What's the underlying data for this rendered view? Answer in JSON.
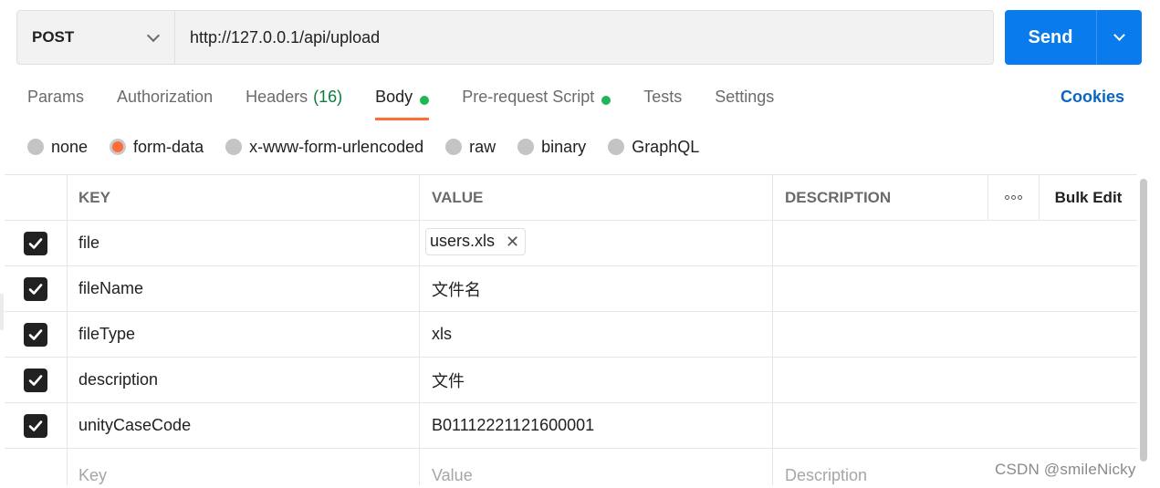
{
  "request": {
    "method": "POST",
    "url": "http://127.0.0.1/api/upload",
    "send_label": "Send"
  },
  "tabs": [
    {
      "label": "Params",
      "active": false
    },
    {
      "label": "Authorization",
      "active": false
    },
    {
      "label": "Headers",
      "count": "(16)",
      "active": false
    },
    {
      "label": "Body",
      "active": true,
      "dot": true
    },
    {
      "label": "Pre-request Script",
      "active": false,
      "dot": true
    },
    {
      "label": "Tests",
      "active": false
    },
    {
      "label": "Settings",
      "active": false
    }
  ],
  "cookies_label": "Cookies",
  "body_types": [
    {
      "label": "none",
      "selected": false
    },
    {
      "label": "form-data",
      "selected": true
    },
    {
      "label": "x-www-form-urlencoded",
      "selected": false
    },
    {
      "label": "raw",
      "selected": false
    },
    {
      "label": "binary",
      "selected": false
    },
    {
      "label": "GraphQL",
      "selected": false
    }
  ],
  "table": {
    "headers": {
      "key": "KEY",
      "value": "VALUE",
      "description": "DESCRIPTION",
      "bulk_edit": "Bulk Edit"
    },
    "rows": [
      {
        "key": "file",
        "value": "users.xls",
        "is_file": true,
        "description": "",
        "checked": true
      },
      {
        "key": "fileName",
        "value": "文件名",
        "description": "",
        "checked": true
      },
      {
        "key": "fileType",
        "value": "xls",
        "description": "",
        "checked": true
      },
      {
        "key": "description",
        "value": "文件",
        "description": "",
        "checked": true
      },
      {
        "key": "unityCaseCode",
        "value": "B01112221121600001",
        "description": "",
        "checked": true
      }
    ],
    "placeholders": {
      "key": "Key",
      "value": "Value",
      "description": "Description"
    }
  },
  "watermark": "CSDN @smileNicky",
  "colors": {
    "accent": "#ff6c37",
    "send": "#097bed",
    "status_dot": "#1eb756",
    "link": "#0b65c2"
  }
}
